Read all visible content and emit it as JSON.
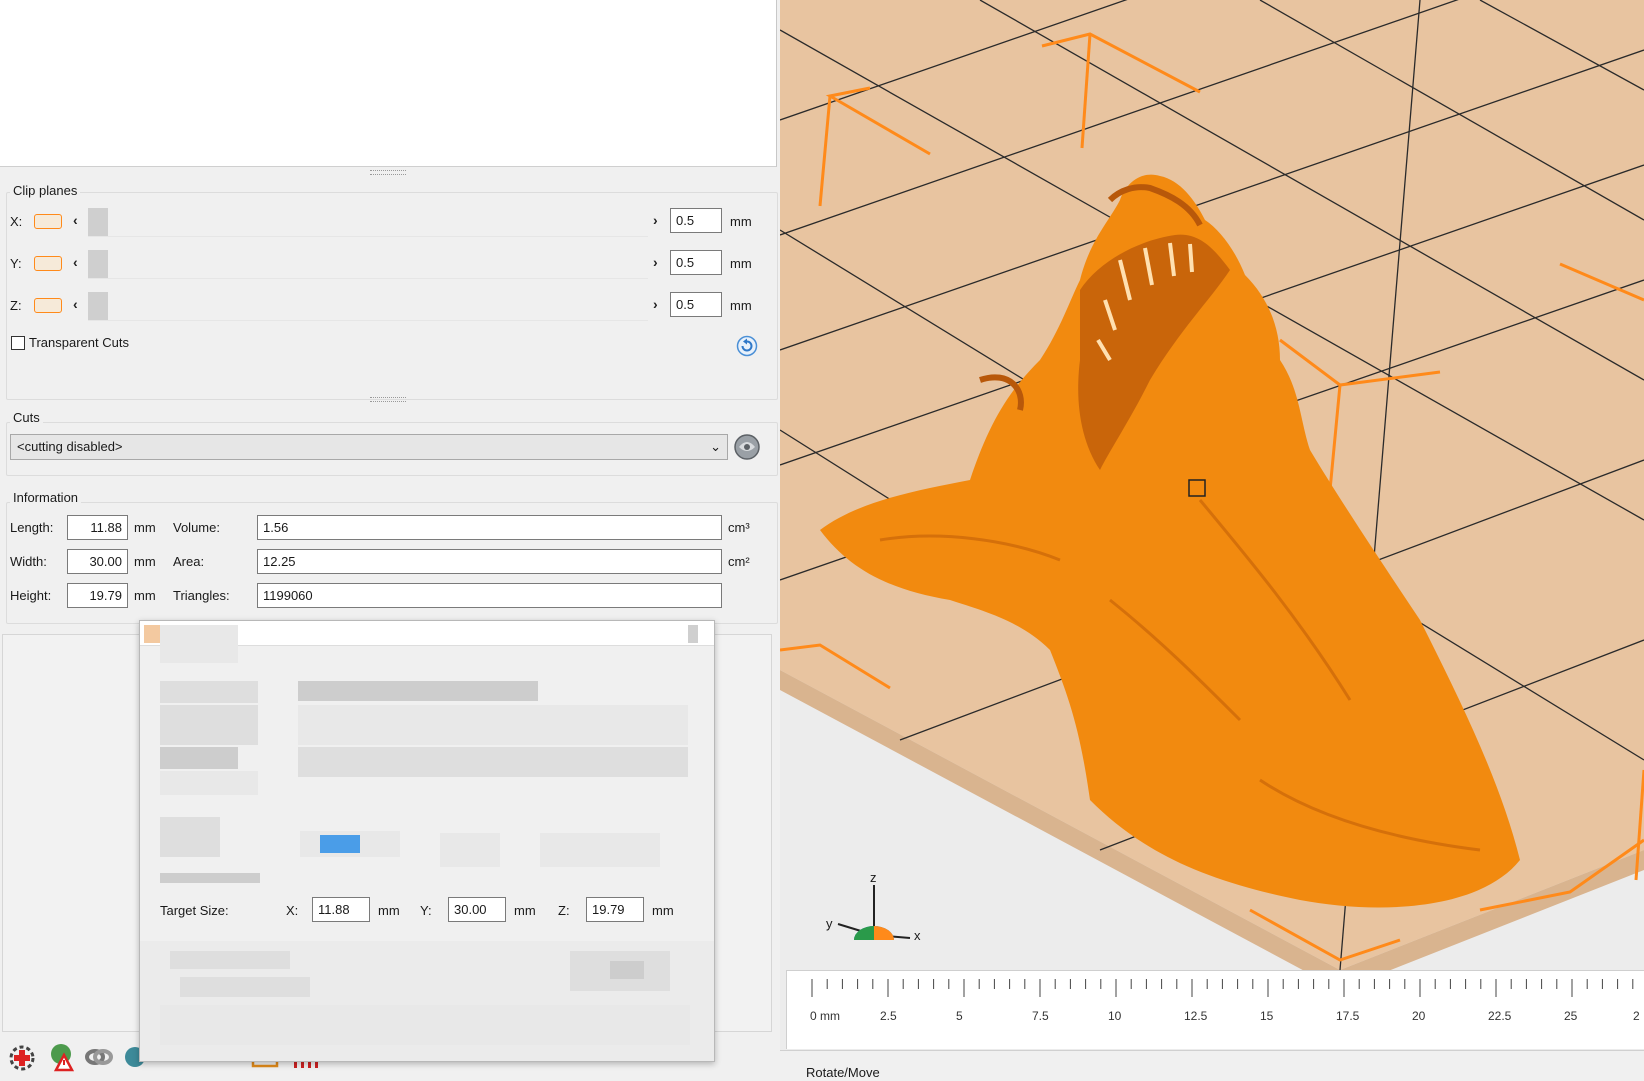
{
  "clip_planes": {
    "title": "Clip planes",
    "axes": [
      {
        "label": "X:",
        "value": "0.5",
        "unit": "mm"
      },
      {
        "label": "Y:",
        "value": "0.5",
        "unit": "mm"
      },
      {
        "label": "Z:",
        "value": "0.5",
        "unit": "mm"
      }
    ],
    "transparent_cuts_label": "Transparent Cuts"
  },
  "cuts": {
    "title": "Cuts",
    "selected": "<cutting disabled>"
  },
  "information": {
    "title": "Information",
    "length_label": "Length:",
    "length_value": "11.88",
    "length_unit": "mm",
    "width_label": "Width:",
    "width_value": "30.00",
    "width_unit": "mm",
    "height_label": "Height:",
    "height_value": "19.79",
    "height_unit": "mm",
    "volume_label": "Volume:",
    "volume_value": "1.56",
    "volume_unit": "cm³",
    "area_label": "Area:",
    "area_value": "12.25",
    "area_unit": "cm²",
    "triangles_label": "Triangles:",
    "triangles_value": "1199060"
  },
  "popup": {
    "target_size_label": "Target Size:",
    "x_label": "X:",
    "x_value": "11.88",
    "x_unit": "mm",
    "y_label": "Y:",
    "y_value": "30.00",
    "y_unit": "mm",
    "z_label": "Z:",
    "z_value": "19.79",
    "z_unit": "mm"
  },
  "viewport": {
    "axis_labels": {
      "x": "x",
      "y": "y",
      "z": "z"
    },
    "ruler_labels": [
      "0 mm",
      "2.5",
      "5",
      "7.5",
      "10",
      "12.5",
      "15",
      "17.5",
      "20",
      "22.5",
      "25",
      "2"
    ]
  },
  "status": {
    "mode": "Rotate/Move"
  },
  "colors": {
    "accent": "#ff8a1a",
    "model": "#f28a0f",
    "plate": "#e8c4a0",
    "selection": "#4a9de8"
  }
}
